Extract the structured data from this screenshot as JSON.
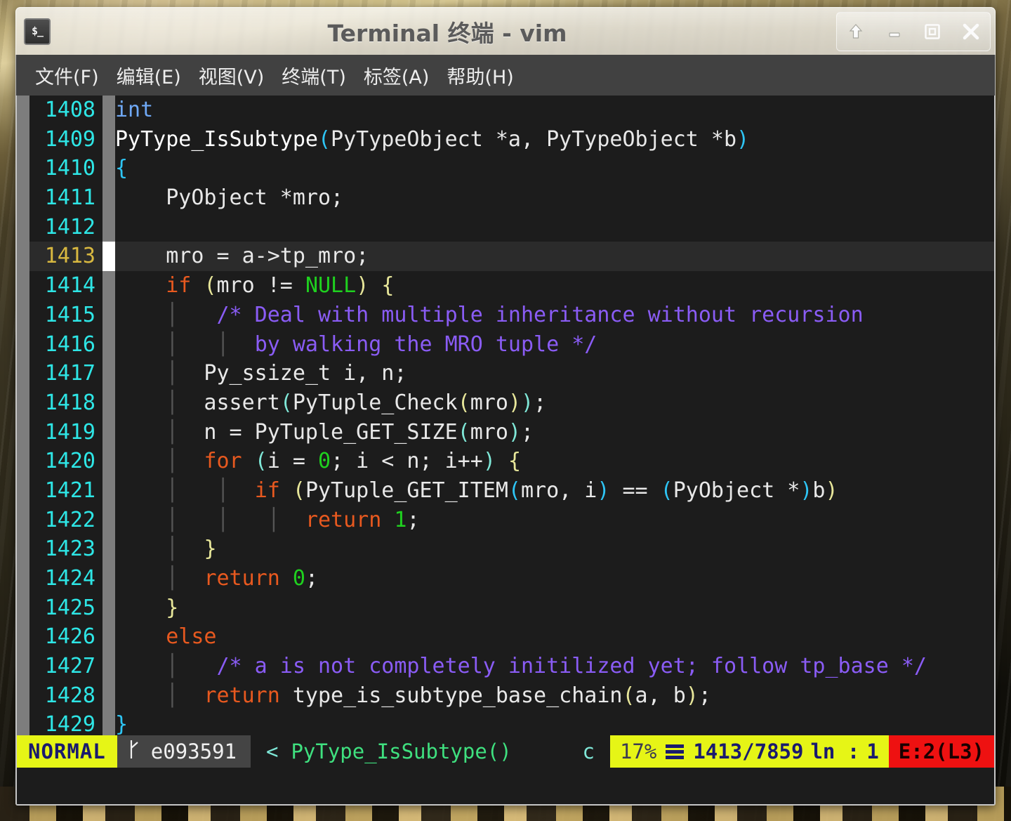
{
  "window": {
    "title": "Terminal 终端 - vim",
    "icon_name": "terminal-icon",
    "icon_glyph": "$_",
    "controls": [
      {
        "name": "shade-button",
        "label": "shade"
      },
      {
        "name": "minimize-button",
        "label": "minimize"
      },
      {
        "name": "maximize-button",
        "label": "maximize"
      },
      {
        "name": "close-button",
        "label": "close"
      }
    ]
  },
  "menubar": {
    "items": [
      {
        "label": "文件(F)"
      },
      {
        "label": "编辑(E)"
      },
      {
        "label": "视图(V)"
      },
      {
        "label": "终端(T)"
      },
      {
        "label": "标签(A)"
      },
      {
        "label": "帮助(H)"
      }
    ]
  },
  "editor": {
    "first_line": 1408,
    "current_line": 1413,
    "lines": [
      {
        "num": "1408",
        "current": false,
        "tokens": [
          {
            "t": "int",
            "c": "c-type"
          }
        ]
      },
      {
        "num": "1409",
        "current": false,
        "tokens": [
          {
            "t": "PyType_IsSubtype",
            "c": "c-fn"
          },
          {
            "t": "(",
            "c": "c-paren1"
          },
          {
            "t": "PyTypeObject *a, PyTypeObject *b",
            "c": "c-plain"
          },
          {
            "t": ")",
            "c": "c-paren1"
          }
        ]
      },
      {
        "num": "1410",
        "current": false,
        "tokens": [
          {
            "t": "{",
            "c": "c-paren1"
          }
        ]
      },
      {
        "num": "1411",
        "current": false,
        "tokens": [
          {
            "t": "    PyObject *mro;",
            "c": "c-plain"
          }
        ]
      },
      {
        "num": "1412",
        "current": false,
        "tokens": [
          {
            "t": "",
            "c": "c-plain"
          }
        ]
      },
      {
        "num": "1413",
        "current": true,
        "tokens": [
          {
            "t": "    mro = a->tp_mro;",
            "c": "c-plain"
          }
        ]
      },
      {
        "num": "1414",
        "current": false,
        "tokens": [
          {
            "t": "    ",
            "c": "c-plain"
          },
          {
            "t": "if",
            "c": "c-kw"
          },
          {
            "t": " ",
            "c": "c-plain"
          },
          {
            "t": "(",
            "c": "c-paren2"
          },
          {
            "t": "mro != ",
            "c": "c-plain"
          },
          {
            "t": "NULL",
            "c": "c-const"
          },
          {
            "t": ")",
            "c": "c-paren2"
          },
          {
            "t": " ",
            "c": "c-plain"
          },
          {
            "t": "{",
            "c": "c-paren2"
          }
        ]
      },
      {
        "num": "1415",
        "current": false,
        "tokens": [
          {
            "t": "    ",
            "c": "c-plain"
          },
          {
            "t": "│",
            "c": "c-ind"
          },
          {
            "t": "   ",
            "c": "c-plain"
          },
          {
            "t": "/* Deal with multiple inheritance without recursion",
            "c": "c-comment"
          }
        ]
      },
      {
        "num": "1416",
        "current": false,
        "tokens": [
          {
            "t": "    ",
            "c": "c-plain"
          },
          {
            "t": "│",
            "c": "c-ind"
          },
          {
            "t": "   ",
            "c": "c-plain"
          },
          {
            "t": "│",
            "c": "c-ind"
          },
          {
            "t": "  ",
            "c": "c-plain"
          },
          {
            "t": "by walking the MRO tuple */",
            "c": "c-comment"
          }
        ]
      },
      {
        "num": "1417",
        "current": false,
        "tokens": [
          {
            "t": "    ",
            "c": "c-plain"
          },
          {
            "t": "│",
            "c": "c-ind"
          },
          {
            "t": "  Py_ssize_t i, n;",
            "c": "c-plain"
          }
        ]
      },
      {
        "num": "1418",
        "current": false,
        "tokens": [
          {
            "t": "    ",
            "c": "c-plain"
          },
          {
            "t": "│",
            "c": "c-ind"
          },
          {
            "t": "  assert",
            "c": "c-plain"
          },
          {
            "t": "(",
            "c": "c-paren3"
          },
          {
            "t": "PyTuple_Check",
            "c": "c-plain"
          },
          {
            "t": "(",
            "c": "c-paren2"
          },
          {
            "t": "mro",
            "c": "c-plain"
          },
          {
            "t": ")",
            "c": "c-paren2"
          },
          {
            "t": ")",
            "c": "c-paren3"
          },
          {
            "t": ";",
            "c": "c-plain"
          }
        ]
      },
      {
        "num": "1419",
        "current": false,
        "tokens": [
          {
            "t": "    ",
            "c": "c-plain"
          },
          {
            "t": "│",
            "c": "c-ind"
          },
          {
            "t": "  n = PyTuple_GET_SIZE",
            "c": "c-plain"
          },
          {
            "t": "(",
            "c": "c-paren3"
          },
          {
            "t": "mro",
            "c": "c-plain"
          },
          {
            "t": ")",
            "c": "c-paren3"
          },
          {
            "t": ";",
            "c": "c-plain"
          }
        ]
      },
      {
        "num": "1420",
        "current": false,
        "tokens": [
          {
            "t": "    ",
            "c": "c-plain"
          },
          {
            "t": "│",
            "c": "c-ind"
          },
          {
            "t": "  ",
            "c": "c-plain"
          },
          {
            "t": "for",
            "c": "c-kw"
          },
          {
            "t": " ",
            "c": "c-plain"
          },
          {
            "t": "(",
            "c": "c-paren3"
          },
          {
            "t": "i = ",
            "c": "c-plain"
          },
          {
            "t": "0",
            "c": "c-const"
          },
          {
            "t": "; i < n; i++",
            "c": "c-plain"
          },
          {
            "t": ")",
            "c": "c-paren3"
          },
          {
            "t": " ",
            "c": "c-plain"
          },
          {
            "t": "{",
            "c": "c-paren2"
          }
        ]
      },
      {
        "num": "1421",
        "current": false,
        "tokens": [
          {
            "t": "    ",
            "c": "c-plain"
          },
          {
            "t": "│",
            "c": "c-ind"
          },
          {
            "t": "   ",
            "c": "c-plain"
          },
          {
            "t": "│",
            "c": "c-ind"
          },
          {
            "t": "  ",
            "c": "c-plain"
          },
          {
            "t": "if",
            "c": "c-kw"
          },
          {
            "t": " ",
            "c": "c-plain"
          },
          {
            "t": "(",
            "c": "c-paren2"
          },
          {
            "t": "PyTuple_GET_ITEM",
            "c": "c-plain"
          },
          {
            "t": "(",
            "c": "c-paren1"
          },
          {
            "t": "mro, i",
            "c": "c-plain"
          },
          {
            "t": ")",
            "c": "c-paren1"
          },
          {
            "t": " == ",
            "c": "c-plain"
          },
          {
            "t": "(",
            "c": "c-paren1"
          },
          {
            "t": "PyObject *",
            "c": "c-plain"
          },
          {
            "t": ")",
            "c": "c-paren1"
          },
          {
            "t": "b",
            "c": "c-plain"
          },
          {
            "t": ")",
            "c": "c-paren2"
          }
        ]
      },
      {
        "num": "1422",
        "current": false,
        "tokens": [
          {
            "t": "    ",
            "c": "c-plain"
          },
          {
            "t": "│",
            "c": "c-ind"
          },
          {
            "t": "   ",
            "c": "c-plain"
          },
          {
            "t": "│",
            "c": "c-ind"
          },
          {
            "t": "   ",
            "c": "c-plain"
          },
          {
            "t": "│",
            "c": "c-ind"
          },
          {
            "t": "  ",
            "c": "c-plain"
          },
          {
            "t": "return",
            "c": "c-kw"
          },
          {
            "t": " ",
            "c": "c-plain"
          },
          {
            "t": "1",
            "c": "c-const"
          },
          {
            "t": ";",
            "c": "c-plain"
          }
        ]
      },
      {
        "num": "1423",
        "current": false,
        "tokens": [
          {
            "t": "    ",
            "c": "c-plain"
          },
          {
            "t": "│",
            "c": "c-ind"
          },
          {
            "t": "  ",
            "c": "c-plain"
          },
          {
            "t": "}",
            "c": "c-paren2"
          }
        ]
      },
      {
        "num": "1424",
        "current": false,
        "tokens": [
          {
            "t": "    ",
            "c": "c-plain"
          },
          {
            "t": "│",
            "c": "c-ind"
          },
          {
            "t": "  ",
            "c": "c-plain"
          },
          {
            "t": "return",
            "c": "c-kw"
          },
          {
            "t": " ",
            "c": "c-plain"
          },
          {
            "t": "0",
            "c": "c-const"
          },
          {
            "t": ";",
            "c": "c-plain"
          }
        ]
      },
      {
        "num": "1425",
        "current": false,
        "tokens": [
          {
            "t": "    ",
            "c": "c-plain"
          },
          {
            "t": "}",
            "c": "c-paren2"
          }
        ]
      },
      {
        "num": "1426",
        "current": false,
        "tokens": [
          {
            "t": "    ",
            "c": "c-plain"
          },
          {
            "t": "else",
            "c": "c-kw"
          }
        ]
      },
      {
        "num": "1427",
        "current": false,
        "tokens": [
          {
            "t": "    ",
            "c": "c-plain"
          },
          {
            "t": "│",
            "c": "c-ind"
          },
          {
            "t": "   ",
            "c": "c-plain"
          },
          {
            "t": "/* a is not completely initilized yet; follow tp_base */",
            "c": "c-comment"
          }
        ]
      },
      {
        "num": "1428",
        "current": false,
        "tokens": [
          {
            "t": "    ",
            "c": "c-plain"
          },
          {
            "t": "│",
            "c": "c-ind"
          },
          {
            "t": "  ",
            "c": "c-plain"
          },
          {
            "t": "return",
            "c": "c-kw"
          },
          {
            "t": " type_is_subtype_base_chain",
            "c": "c-plain"
          },
          {
            "t": "(",
            "c": "c-paren2"
          },
          {
            "t": "a, b",
            "c": "c-plain"
          },
          {
            "t": ")",
            "c": "c-paren2"
          },
          {
            "t": ";",
            "c": "c-plain"
          }
        ]
      },
      {
        "num": "1429",
        "current": false,
        "tokens": [
          {
            "t": "}",
            "c": "c-paren1"
          }
        ]
      }
    ]
  },
  "statusline": {
    "mode": "NORMAL",
    "branch_icon": "git-branch-icon",
    "branch": "e093591",
    "separator": "<",
    "function": "PyType_IsSubtype()",
    "filetype": "c",
    "percent": "17%",
    "linecount_icon": "line-number-icon",
    "position": "1413/7859",
    "col_label": "ln :",
    "col_value": "1",
    "errors": "E:2(L3)"
  },
  "colors": {
    "accent_yellow": "#e6f516",
    "error_red": "#ee1111",
    "linenr_cyan": "#2ee6e6",
    "current_linenr": "#d8b840",
    "keyword_orange": "#e8591f",
    "constant_green": "#1fd11f",
    "comment_purple": "#8a5cf5",
    "terminal_bg": "#1c1c1c"
  }
}
